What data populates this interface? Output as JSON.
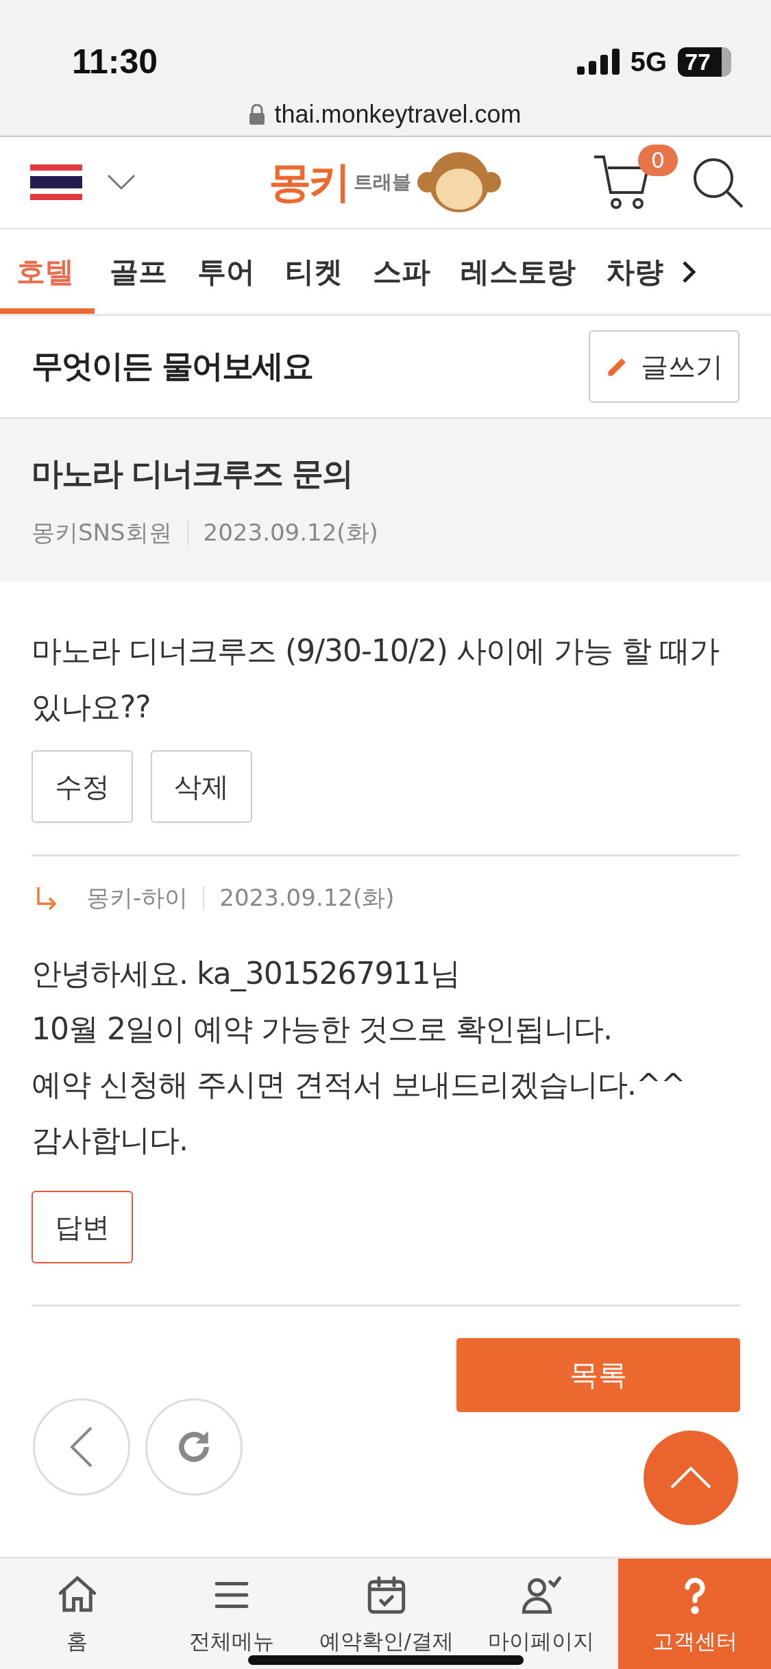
{
  "status_bar": {
    "time": "11:30",
    "network": "5G",
    "battery": "77"
  },
  "browser": {
    "url": "thai.monkeytravel.com"
  },
  "header": {
    "logo_main": "몽키",
    "logo_sub": "트래블",
    "cart_count": "0"
  },
  "tabs": [
    {
      "label": "호텔",
      "selected": true
    },
    {
      "label": "골프",
      "selected": false
    },
    {
      "label": "투어",
      "selected": false
    },
    {
      "label": "티켓",
      "selected": false
    },
    {
      "label": "스파",
      "selected": false
    },
    {
      "label": "레스토랑",
      "selected": false
    },
    {
      "label": "차량",
      "selected": false
    }
  ],
  "section": {
    "title": "무엇이든 물어보세요",
    "write_button": "글쓰기"
  },
  "post": {
    "title": "마노라 디너크루즈 문의",
    "author": "몽키SNS회원",
    "date": "2023.09.12(화)",
    "body": "마노라 디너크루즈 (9/30-10/2) 사이에 가능 할 때가 있나요??",
    "actions": [
      "수정",
      "삭제"
    ]
  },
  "reply": {
    "author": "몽키-하이",
    "date": "2023.09.12(화)",
    "lines": [
      "안녕하세요. ka_3015267911님",
      "10월 2일이 예약 가능한 것으로 확인됩니다.",
      "예약 신청해 주시면 견적서 보내드리겠습니다.^^",
      "감사합니다."
    ],
    "button": "답변"
  },
  "list_button": "목록",
  "bottom_nav": [
    {
      "label": "홈",
      "kind": "home",
      "selected": false
    },
    {
      "label": "전체메뉴",
      "kind": "menu",
      "selected": false
    },
    {
      "label": "예약확인/결제",
      "kind": "calendar",
      "selected": false
    },
    {
      "label": "마이페이지",
      "kind": "user",
      "selected": false
    },
    {
      "label": "고객센터",
      "kind": "help",
      "selected": true
    }
  ]
}
